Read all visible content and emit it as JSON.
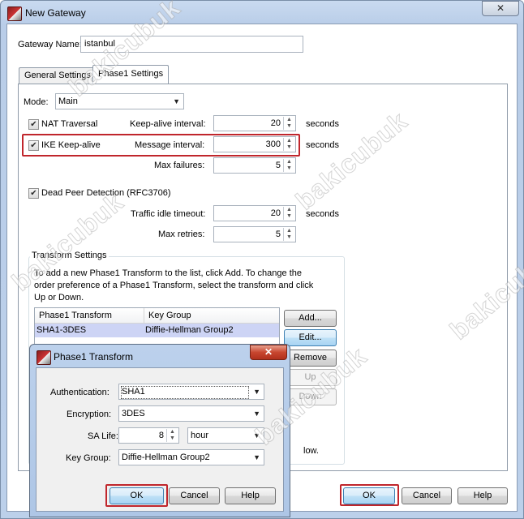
{
  "window": {
    "title": "New Gateway",
    "close_glyph": "✕"
  },
  "gateway_name": {
    "label": "Gateway Name:",
    "value": "istanbul"
  },
  "tabs": [
    {
      "label": "General Settings"
    },
    {
      "label": "Phase1 Settings"
    }
  ],
  "mode": {
    "label": "Mode:",
    "value": "Main"
  },
  "nat": {
    "label": "NAT Traversal",
    "checked": true,
    "interval_label": "Keep-alive interval:",
    "interval_value": "20",
    "unit": "seconds"
  },
  "ike": {
    "label": "IKE Keep-alive",
    "checked": true,
    "message_label": "Message interval:",
    "message_value": "300",
    "unit": "seconds",
    "max_failures_label": "Max failures:",
    "max_failures_value": "5"
  },
  "dpd": {
    "label": "Dead Peer Detection (RFC3706)",
    "checked": true,
    "idle_label": "Traffic idle timeout:",
    "idle_value": "20",
    "unit": "seconds",
    "retries_label": "Max retries:",
    "retries_value": "5"
  },
  "transform": {
    "group_title": "Transform Settings",
    "line1": "To add a new Phase1 Transform to the list, click Add. To change the",
    "line2": "order preference of a Phase1 Transform, select the transform and click",
    "line3": "Up or Down.",
    "columns": [
      "Phase1 Transform",
      "Key Group"
    ],
    "rows": [
      [
        "SHA1-3DES",
        "Diffie-Hellman Group2"
      ]
    ],
    "buttons": {
      "add": "Add...",
      "edit": "Edit...",
      "remove": "Remove",
      "up": "Up",
      "down": "Down"
    },
    "tail_text": "low."
  },
  "footer": {
    "ok": "OK",
    "cancel": "Cancel",
    "help": "Help"
  },
  "dialog": {
    "title": "Phase1 Transform",
    "auth_label": "Authentication:",
    "auth_value": "SHA1",
    "enc_label": "Encryption:",
    "enc_value": "3DES",
    "sa_label": "SA Life:",
    "sa_value": "8",
    "sa_unit": "hour",
    "kg_label": "Key Group:",
    "kg_value": "Diffie-Hellman Group2",
    "ok": "OK",
    "cancel": "Cancel",
    "help": "Help"
  },
  "watermark": "bakicubuk",
  "colors": {
    "highlight": "#c0262c",
    "selected_row": "#cdd4f5"
  }
}
